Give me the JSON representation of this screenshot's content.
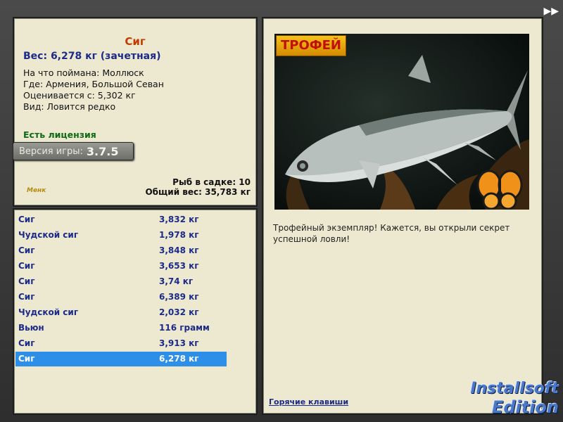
{
  "fish": {
    "name": "Сиг",
    "weight_line": "Вес: 6,278 кг (зачетная)",
    "caught_on": "На что поймана: Моллюск",
    "location": "Где: Армения, Большой Севан",
    "rated_from": "Оценивается с: 5,302 кг",
    "species_note": "Вид: Ловится редко",
    "license": "Есть лицензия"
  },
  "version": {
    "label": "Версия игры:",
    "number": "3.7.5"
  },
  "mini_logo": "Менк",
  "stats": {
    "fish_in_net": "Рыб в садке: 10",
    "total_weight": "Общий вес: 35,783 кг"
  },
  "catch_list": [
    {
      "name": "Сиг",
      "weight": "3,832 кг"
    },
    {
      "name": "Чудской сиг",
      "weight": "1,978 кг"
    },
    {
      "name": "Сиг",
      "weight": "3,848 кг"
    },
    {
      "name": "Сиг",
      "weight": "3,653 кг"
    },
    {
      "name": "Сиг",
      "weight": "3,74 кг"
    },
    {
      "name": "Сиг",
      "weight": "6,389 кг"
    },
    {
      "name": "Чудской сиг",
      "weight": "2,032 кг"
    },
    {
      "name": "Вьюн",
      "weight": "116 грамм"
    },
    {
      "name": "Сиг",
      "weight": "3,913 кг"
    },
    {
      "name": "Сиг",
      "weight": "6,278 кг"
    }
  ],
  "selected_index": 9,
  "detail": {
    "trophy_label": "ТРОФЕЙ",
    "description": "Трофейный экземпляр! Кажется, вы открыли секрет успешной ловли!",
    "hotkeys_link": "Горячие клавиши"
  },
  "brand": {
    "line1": "Installsoft",
    "line2": "Edition"
  },
  "nav": {
    "forward_glyph": "▶▶"
  },
  "colors": {
    "panel_bg": "#ece9d0",
    "fish_name": "#c03c00",
    "list_text": "#1c2a8a",
    "selection": "#2e8fe8",
    "license": "#0f6a14"
  }
}
